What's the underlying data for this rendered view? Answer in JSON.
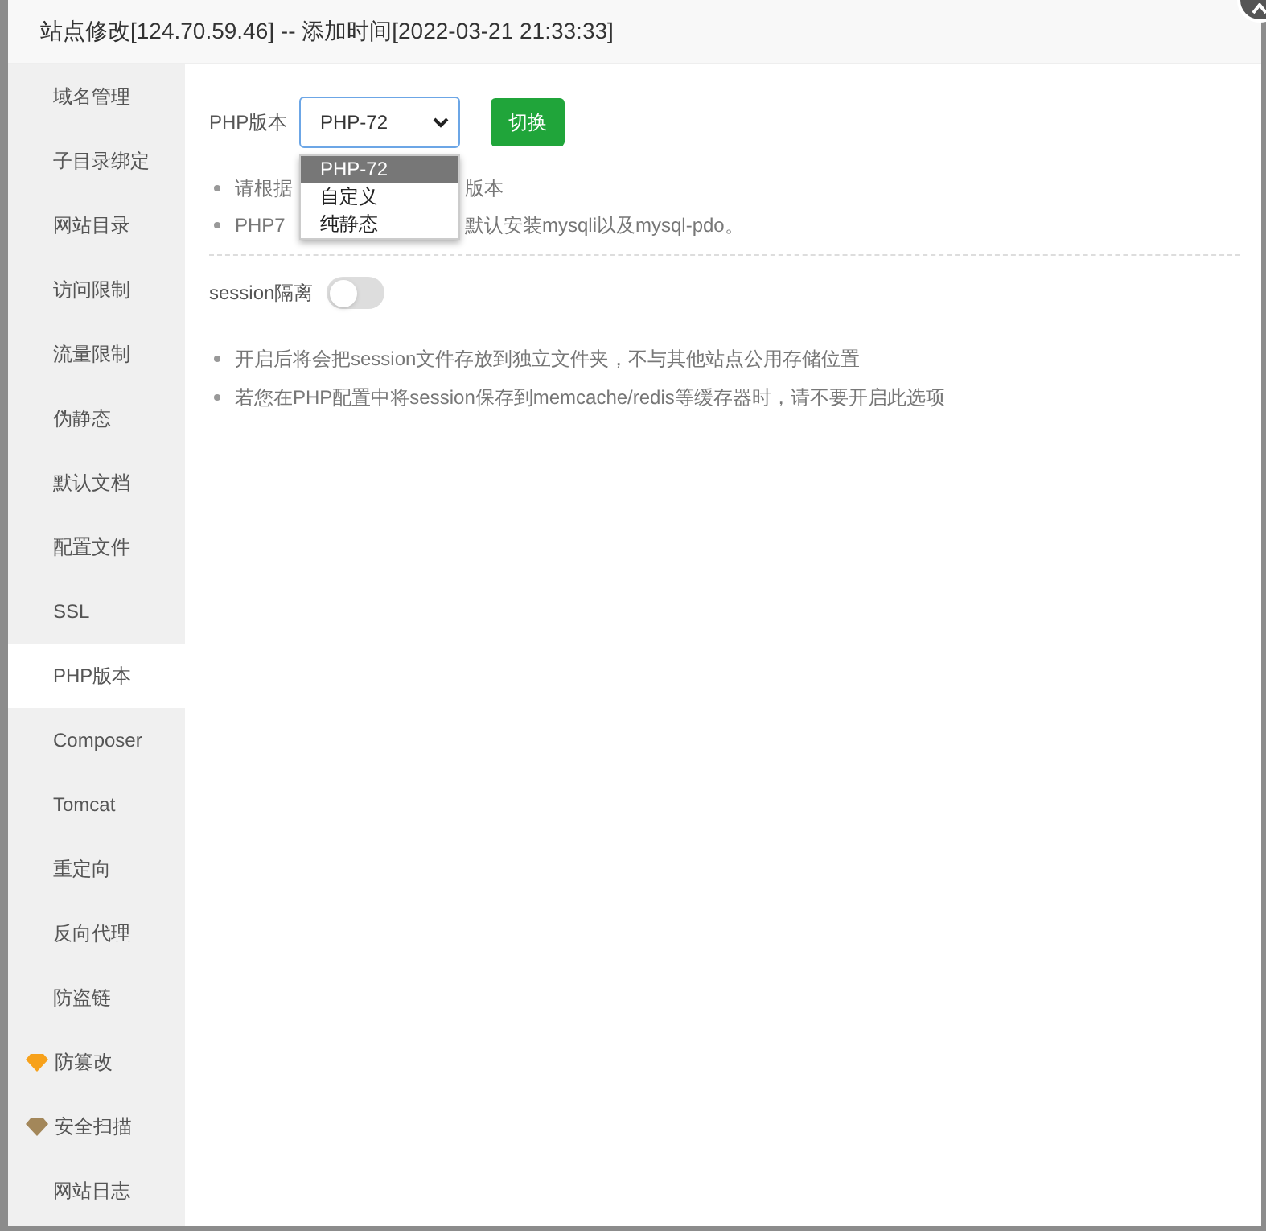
{
  "dialog": {
    "title": "站点修改[124.70.59.46] -- 添加时间[2022-03-21 21:33:33]"
  },
  "sidebar": {
    "items": [
      {
        "label": "域名管理",
        "selected": false
      },
      {
        "label": "子目录绑定",
        "selected": false
      },
      {
        "label": "网站目录",
        "selected": false
      },
      {
        "label": "访问限制",
        "selected": false
      },
      {
        "label": "流量限制",
        "selected": false
      },
      {
        "label": "伪静态",
        "selected": false
      },
      {
        "label": "默认文档",
        "selected": false
      },
      {
        "label": "配置文件",
        "selected": false
      },
      {
        "label": "SSL",
        "selected": false
      },
      {
        "label": "PHP版本",
        "selected": true
      },
      {
        "label": "Composer",
        "selected": false
      },
      {
        "label": "Tomcat",
        "selected": false
      },
      {
        "label": "重定向",
        "selected": false
      },
      {
        "label": "反向代理",
        "selected": false
      },
      {
        "label": "防盗链",
        "selected": false
      },
      {
        "label": "防篡改",
        "selected": false,
        "color": "#f7a11a"
      },
      {
        "label": "安全扫描",
        "selected": false,
        "color": "#a3875a"
      },
      {
        "label": "网站日志",
        "selected": false
      }
    ]
  },
  "php": {
    "label": "PHP版本",
    "value": "PHP-72",
    "button": "切换",
    "options": [
      {
        "label": "PHP-72",
        "selected": true
      },
      {
        "label": "自定义",
        "selected": false
      },
      {
        "label": "纯静态",
        "selected": false
      }
    ],
    "hints": [
      {
        "before": "请根据",
        "after": "版本"
      },
      {
        "before": "PHP7",
        "after": "默认安装mysqli以及mysql-pdo。"
      }
    ]
  },
  "session": {
    "label": "session隔离",
    "on": false,
    "hints": [
      "开启后将会把session文件存放到独立文件夹，不与其他站点公用存储位置",
      "若您在PHP配置中将session保存到memcache/redis等缓存器时，请不要开启此选项"
    ]
  }
}
